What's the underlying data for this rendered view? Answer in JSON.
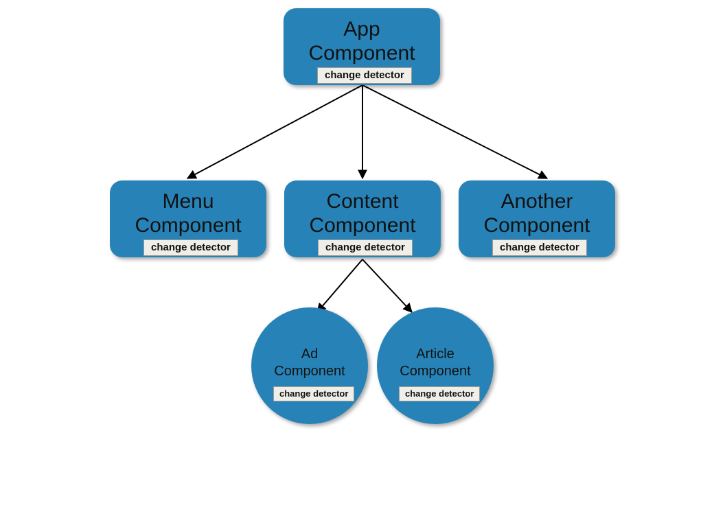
{
  "colors": {
    "node_fill": "#2783b7",
    "badge_bg": "#f0eee9",
    "badge_border": "#9c9a94"
  },
  "badge_label": "change detector",
  "nodes": {
    "app": {
      "line1": "App",
      "line2": "Component"
    },
    "menu": {
      "line1": "Menu",
      "line2": "Component"
    },
    "content": {
      "line1": "Content",
      "line2": "Component"
    },
    "another": {
      "line1": "Another",
      "line2": "Component"
    },
    "ad": {
      "line1": "Ad",
      "line2": "Component"
    },
    "article": {
      "line1": "Article",
      "line2": "Component"
    }
  },
  "edges": [
    {
      "from": "app",
      "to": "menu"
    },
    {
      "from": "app",
      "to": "content"
    },
    {
      "from": "app",
      "to": "another"
    },
    {
      "from": "content",
      "to": "ad"
    },
    {
      "from": "content",
      "to": "article"
    }
  ]
}
